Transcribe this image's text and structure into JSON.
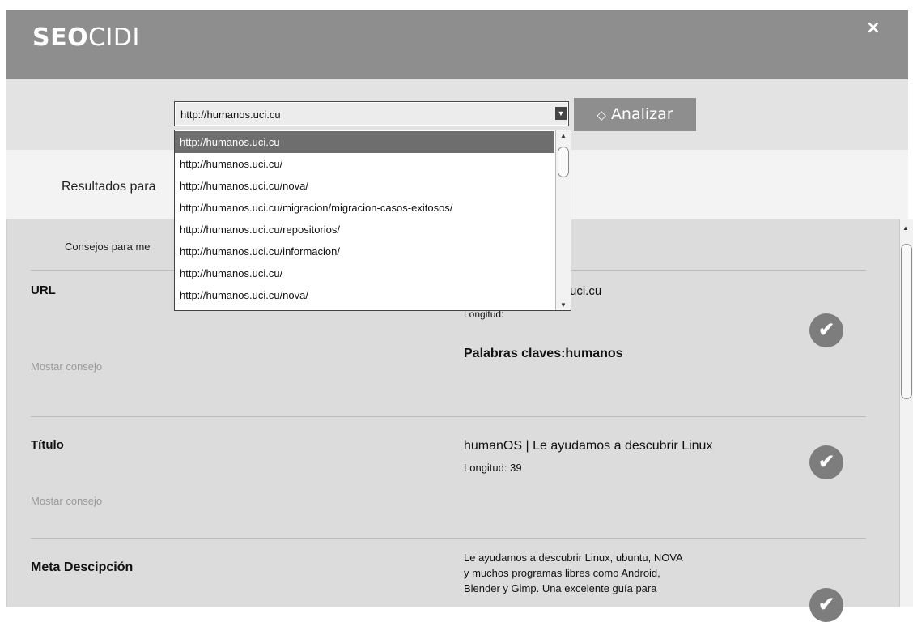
{
  "header": {
    "logo_bold": "SEO",
    "logo_light": "CIDI",
    "close_label": "×"
  },
  "toolbar": {
    "selected_url": "http://humanos.uci.cu",
    "analyze_label": "Analizar",
    "analyze_icon": "diamond-icon"
  },
  "dropdown": {
    "options": [
      "http://humanos.uci.cu",
      "http://humanos.uci.cu/",
      "http://humanos.uci.cu/nova/",
      "http://humanos.uci.cu/migracion/migracion-casos-exitosos/",
      "http://humanos.uci.cu/repositorios/",
      "http://humanos.uci.cu/informacion/",
      "http://humanos.uci.cu/",
      "http://humanos.uci.cu/nova/"
    ]
  },
  "results": {
    "label": "Resultados para"
  },
  "content": {
    "tips_label": "Consejos para me",
    "sections": [
      {
        "title": "URL",
        "tip_link": "Mostar consejo",
        "value_partial": "uci.cu",
        "length_partial": "Longitud:",
        "keywords": "Palabras claves:humanos"
      },
      {
        "title": "Título",
        "tip_link": "Mostar consejo",
        "value": "humanOS | Le ayudamos a descubrir Linux",
        "length": "Longitud: 39"
      },
      {
        "title": "Meta Descipción",
        "value_lines": [
          "Le ayudamos a descubrir Linux, ubuntu, NOVA",
          "y muchos programas libres como Android,",
          "Blender y Gimp. Una excelente guía para"
        ]
      }
    ]
  },
  "colors": {
    "header_bg": "#8e8e8e",
    "toolbar_bg": "#e3e3e3",
    "content_bg": "#dcdcdc",
    "check_bg": "#7d7d7d",
    "selected_option_bg": "#6e6e6e"
  }
}
